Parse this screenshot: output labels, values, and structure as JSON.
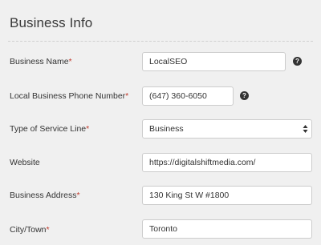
{
  "panel": {
    "title": "Business Info"
  },
  "required_marker": "*",
  "fields": [
    {
      "label": "Business Name",
      "value": "LocalSEO",
      "required": true,
      "help": "?"
    },
    {
      "label": "Local Business Phone Number",
      "value": "(647) 360-6050",
      "required": true,
      "help": "?"
    },
    {
      "label": "Type of Service Line",
      "value": "Business",
      "required": true
    },
    {
      "label": "Website",
      "value": "https://digitalshiftmedia.com/",
      "required": false
    },
    {
      "label": "Business Address",
      "value": "130 King St W #1800",
      "required": true
    },
    {
      "label": "City/Town",
      "value": "Toronto",
      "required": true
    }
  ]
}
